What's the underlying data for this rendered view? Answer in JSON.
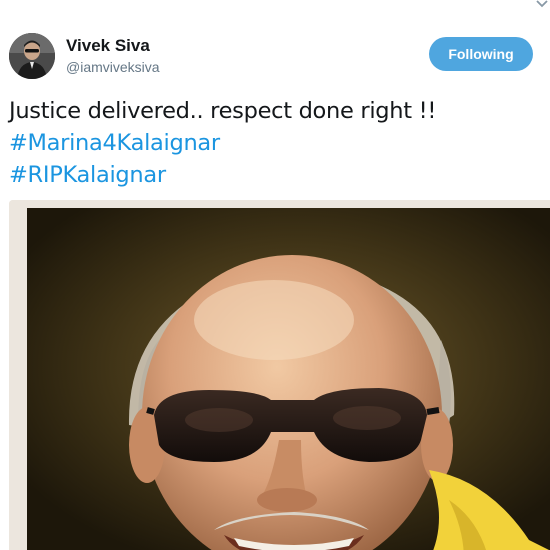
{
  "tweet": {
    "author": {
      "display_name": "Vivek Siva",
      "handle": "@iamviveksiva"
    },
    "follow_button_label": "Following",
    "text": {
      "line1": "Justice delivered.. respect done right !!",
      "hashtags": [
        "#Marina4Kalaignar",
        "#RIPKalaignar"
      ]
    },
    "media": {
      "type": "photo"
    }
  },
  "colors": {
    "hashtag": "#1b95e0",
    "follow_button": "#4fa6df",
    "name": "#14171a",
    "handle": "#657786"
  },
  "icons": {
    "more": "chevron-down-icon"
  }
}
